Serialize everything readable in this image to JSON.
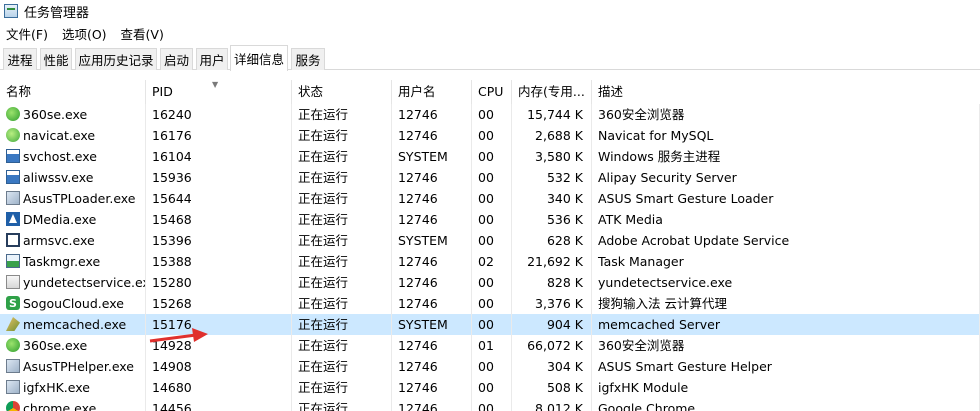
{
  "window": {
    "title": "任务管理器",
    "icon": "task-manager-icon"
  },
  "menu": [
    "文件(F)",
    "选项(O)",
    "查看(V)"
  ],
  "tabs": [
    "进程",
    "性能",
    "应用历史记录",
    "启动",
    "用户",
    "详细信息",
    "服务"
  ],
  "active_tab": "详细信息",
  "columns": [
    "名称",
    "PID",
    "状态",
    "用户名",
    "CPU",
    "内存(专用...",
    "描述"
  ],
  "sorted_column": "PID",
  "selected_row": "memcached.exe",
  "colors": {
    "selected_row_bg": "#cce8ff",
    "annotation_arrow": "#e0302d"
  },
  "rows": [
    {
      "icon": "360-browser-icon",
      "name": "360se.exe",
      "pid": "16240",
      "status": "正在运行",
      "user": "12746",
      "cpu": "00",
      "mem": "15,744 K",
      "desc": "360安全浏览器"
    },
    {
      "icon": "navicat-icon",
      "name": "navicat.exe",
      "pid": "16176",
      "status": "正在运行",
      "user": "12746",
      "cpu": "00",
      "mem": "2,688 K",
      "desc": "Navicat for MySQL"
    },
    {
      "icon": "windows-service-icon",
      "name": "svchost.exe",
      "pid": "16104",
      "status": "正在运行",
      "user": "SYSTEM",
      "cpu": "00",
      "mem": "3,580 K",
      "desc": "Windows 服务主进程"
    },
    {
      "icon": "windows-service-icon",
      "name": "aliwssv.exe",
      "pid": "15936",
      "status": "正在运行",
      "user": "12746",
      "cpu": "00",
      "mem": "532 K",
      "desc": "Alipay Security Server"
    },
    {
      "icon": "asus-app-icon",
      "name": "AsusTPLoader.exe",
      "pid": "15644",
      "status": "正在运行",
      "user": "12746",
      "cpu": "00",
      "mem": "340 K",
      "desc": "ASUS Smart Gesture Loader"
    },
    {
      "icon": "dmedia-icon",
      "name": "DMedia.exe",
      "pid": "15468",
      "status": "正在运行",
      "user": "12746",
      "cpu": "00",
      "mem": "536 K",
      "desc": "ATK Media"
    },
    {
      "icon": "window-frame-icon",
      "name": "armsvc.exe",
      "pid": "15396",
      "status": "正在运行",
      "user": "SYSTEM",
      "cpu": "00",
      "mem": "628 K",
      "desc": "Adobe Acrobat Update Service"
    },
    {
      "icon": "task-manager-icon",
      "name": "Taskmgr.exe",
      "pid": "15388",
      "status": "正在运行",
      "user": "12746",
      "cpu": "02",
      "mem": "21,692 K",
      "desc": "Task Manager"
    },
    {
      "icon": "document-icon",
      "name": "yundetectservice.exe",
      "pid": "15280",
      "status": "正在运行",
      "user": "12746",
      "cpu": "00",
      "mem": "828 K",
      "desc": "yundetectservice.exe"
    },
    {
      "icon": "sogou-icon",
      "name": "SogouCloud.exe",
      "pid": "15268",
      "status": "正在运行",
      "user": "12746",
      "cpu": "00",
      "mem": "3,376 K",
      "desc": "搜狗输入法 云计算代理"
    },
    {
      "icon": "memcached-icon",
      "name": "memcached.exe",
      "pid": "15176",
      "status": "正在运行",
      "user": "SYSTEM",
      "cpu": "00",
      "mem": "904 K",
      "desc": "memcached Server"
    },
    {
      "icon": "360-browser-icon",
      "name": "360se.exe",
      "pid": "14928",
      "status": "正在运行",
      "user": "12746",
      "cpu": "01",
      "mem": "66,072 K",
      "desc": "360安全浏览器"
    },
    {
      "icon": "asus-app-icon",
      "name": "AsusTPHelper.exe",
      "pid": "14908",
      "status": "正在运行",
      "user": "12746",
      "cpu": "00",
      "mem": "304 K",
      "desc": "ASUS Smart Gesture Helper"
    },
    {
      "icon": "asus-app-icon",
      "name": "igfxHK.exe",
      "pid": "14680",
      "status": "正在运行",
      "user": "12746",
      "cpu": "00",
      "mem": "508 K",
      "desc": "igfxHK Module"
    },
    {
      "icon": "chrome-icon",
      "name": "chrome.exe",
      "pid": "14456",
      "status": "正在运行",
      "user": "12746",
      "cpu": "00",
      "mem": "8,012 K",
      "desc": "Google Chrome"
    }
  ]
}
